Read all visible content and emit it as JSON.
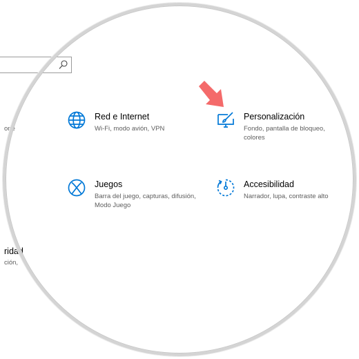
{
  "search": {
    "icon": "search-icon"
  },
  "fragments": {
    "left_top_desc": "one",
    "left_bottom_title": "ridad",
    "left_bottom_desc": "ción,"
  },
  "tiles": [
    {
      "title": "Red e Internet",
      "description": "Wi-Fi, modo avión, VPN",
      "icon": "globe-icon"
    },
    {
      "title": "Personalización",
      "description": "Fondo, pantalla de bloqueo, colores",
      "icon": "personalization-icon"
    },
    {
      "title": "Juegos",
      "description": "Barra del juego, capturas, difusión, Modo Juego",
      "icon": "xbox-icon"
    },
    {
      "title": "Accesibilidad",
      "description": "Narrador, lupa, contraste alto",
      "icon": "accessibility-icon"
    }
  ],
  "annotation": {
    "icon": "pointer-arrow-icon",
    "color": "#f46a6a"
  },
  "colors": {
    "accent": "#0078d7",
    "text": "#000000",
    "subtext": "#5d5d5d",
    "arrow": "#f46a6a"
  }
}
